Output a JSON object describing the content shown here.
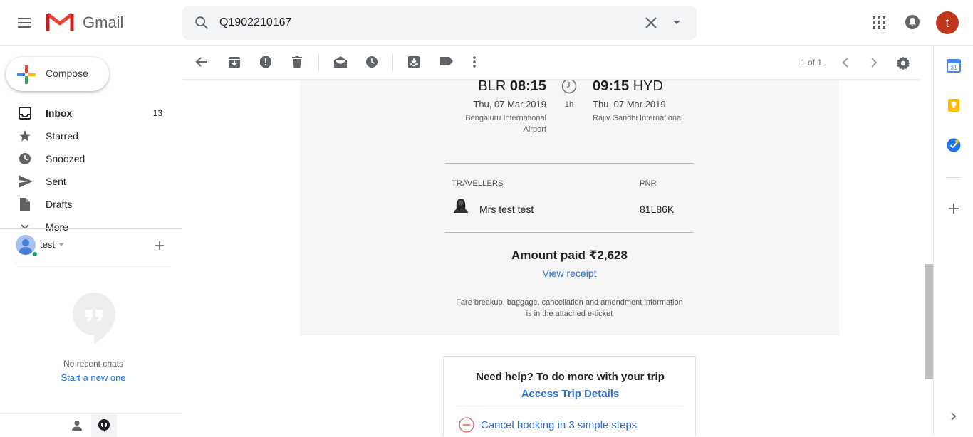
{
  "app": {
    "name": "Gmail"
  },
  "search": {
    "query": "Q1902210167"
  },
  "account": {
    "initial": "t"
  },
  "compose": {
    "label": "Compose"
  },
  "sidebar": {
    "items": [
      {
        "label": "Inbox",
        "count": "13",
        "bold": true,
        "icon": "inbox-icon"
      },
      {
        "label": "Starred",
        "count": "",
        "icon": "star-icon"
      },
      {
        "label": "Snoozed",
        "count": "",
        "icon": "clock-icon"
      },
      {
        "label": "Sent",
        "count": "",
        "icon": "send-icon"
      },
      {
        "label": "Drafts",
        "count": "",
        "icon": "draft-icon"
      },
      {
        "label": "More",
        "count": "",
        "icon": "chevron-down-icon"
      }
    ]
  },
  "hangouts": {
    "user_name": "test",
    "no_chats": "No recent chats",
    "start_new": "Start a new one"
  },
  "toolbar": {
    "page_count": "1 of 1"
  },
  "email": {
    "departure": {
      "code": "BLR",
      "time": "08:15",
      "date": "Thu, 07 Mar 2019",
      "airport_line1": "Bengaluru International",
      "airport_line2": "Airport"
    },
    "duration": "1h",
    "arrival": {
      "code": "HYD",
      "time": "09:15",
      "date": "Thu, 07 Mar 2019",
      "airport_line1": "Rajiv Gandhi International"
    },
    "travellers_header": "TRAVELLERS",
    "pnr_header": "PNR",
    "traveller_name": "Mrs test test",
    "pnr": "81L86K",
    "amount_paid": "Amount paid ₹2,628",
    "view_receipt": "View receipt",
    "fare_info_line1": "Fare breakup, baggage, cancellation and amendment information",
    "fare_info_line2": "is in the attached e-ticket",
    "help_title": "Need help? To do more with your trip",
    "help_link": "Access Trip Details",
    "cancel_link": "Cancel booking in 3 simple steps"
  },
  "colors": {
    "gmail_red": "#ea4335",
    "link_blue": "#2c6fca",
    "avatar_bg": "#c1351d",
    "card_bg": "#f5f5f5"
  }
}
